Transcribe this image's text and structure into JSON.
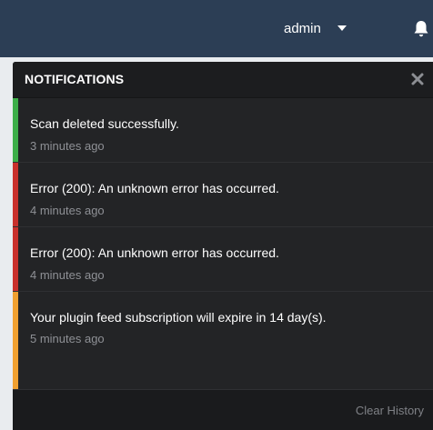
{
  "topbar": {
    "user_label": "admin",
    "user_menu_icon": "chevron-down-icon",
    "notifications_icon": "bell-icon"
  },
  "panel": {
    "title": "NOTIFICATIONS",
    "close_icon": "close-icon",
    "footer_action": "Clear History"
  },
  "notifications": [
    {
      "message": "Scan deleted successfully.",
      "time": "3 minutes ago",
      "status": "success",
      "color": "#3dae49"
    },
    {
      "message": "Error (200): An unknown error has occurred.",
      "time": "4 minutes ago",
      "status": "error",
      "color": "#c9302c"
    },
    {
      "message": "Error (200): An unknown error has occurred.",
      "time": "4 minutes ago",
      "status": "error",
      "color": "#c9302c"
    },
    {
      "message": "Your plugin feed subscription will expire in 14 day(s).",
      "time": "5 minutes ago",
      "status": "warning",
      "color": "#f0a030"
    }
  ],
  "colors": {
    "topbar": "#2c3e55",
    "panel_background": "#232426",
    "success": "#3dae49",
    "error": "#c9302c",
    "warning": "#f0a030"
  }
}
